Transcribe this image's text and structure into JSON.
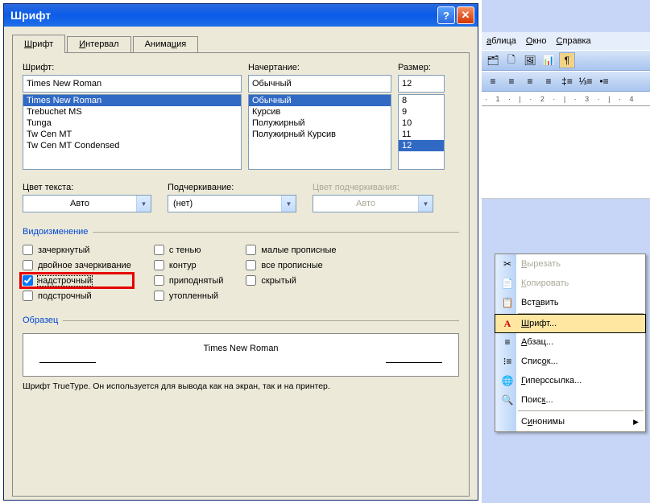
{
  "dialog": {
    "title": "Шрифт",
    "tabs": [
      "Шрифт",
      "Интервал",
      "Анимация"
    ],
    "font_label": "Шрифт:",
    "font_value": "Times New Roman",
    "font_options": [
      "Times New Roman",
      "Trebuchet MS",
      "Tunga",
      "Tw Cen MT",
      "Tw Cen MT Condensed"
    ],
    "style_label": "Начертание:",
    "style_value": "Обычный",
    "style_options": [
      "Обычный",
      "Курсив",
      "Полужирный",
      "Полужирный Курсив"
    ],
    "size_label": "Размер:",
    "size_value": "12",
    "size_options": [
      "8",
      "9",
      "10",
      "11",
      "12"
    ],
    "color_label": "Цвет текста:",
    "color_value": "Авто",
    "underline_label": "Подчеркивание:",
    "underline_value": "(нет)",
    "underline_color_label": "Цвет подчеркивания:",
    "underline_color_value": "Авто",
    "effects_legend": "Видоизменение",
    "effects": {
      "col1": [
        "зачеркнутый",
        "двойное зачеркивание",
        "надстрочный",
        "подстрочный"
      ],
      "col2": [
        "с тенью",
        "контур",
        "приподнятый",
        "утопленный"
      ],
      "col3": [
        "малые прописные",
        "все прописные",
        "скрытый"
      ]
    },
    "sample_legend": "Образец",
    "sample_text": "Times New Roman",
    "info": "Шрифт TrueType. Он используется для вывода как на экран, так и на принтер."
  },
  "word": {
    "menus": [
      "аблица",
      "Окно",
      "Справка"
    ],
    "ruler": "· 1 · | · 2 · | · 3 · | · 4"
  },
  "context_menu": {
    "items": [
      {
        "icon": "✂",
        "label": "Вырезать",
        "disabled": true,
        "u": 0
      },
      {
        "icon": "📄",
        "label": "Копировать",
        "disabled": true,
        "u": 0
      },
      {
        "icon": "📋",
        "label": "Вставить",
        "u": 3
      },
      {
        "sep": true
      },
      {
        "icon": "A",
        "label": "Шрифт...",
        "hl": true,
        "u": 0
      },
      {
        "icon": "≡",
        "label": "Абзац...",
        "u": 0
      },
      {
        "icon": "⁝≡",
        "label": "Список...",
        "u": 4
      },
      {
        "icon": "🔗",
        "label": "Гиперссылка...",
        "u": 0
      },
      {
        "icon": "🔍",
        "label": "Поиск...",
        "u": 3
      },
      {
        "sep": true
      },
      {
        "icon": "",
        "label": "Синонимы",
        "arrow": true,
        "u": 2
      }
    ]
  }
}
